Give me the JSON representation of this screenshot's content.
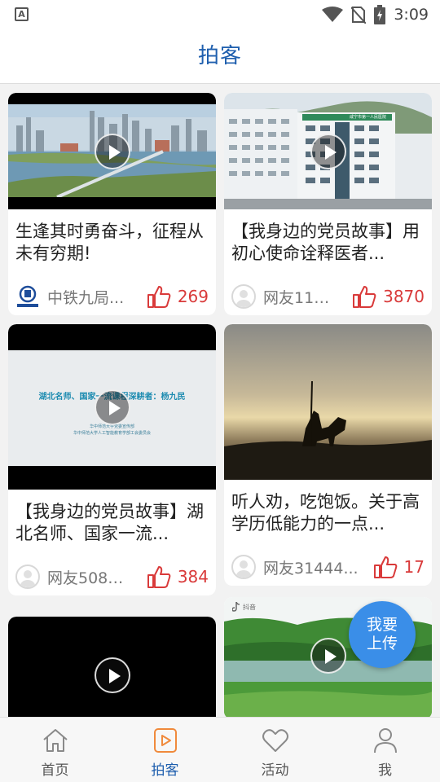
{
  "status_bar": {
    "time": "3:09",
    "app_badge": "A",
    "icons": [
      "wifi-icon",
      "no-sim-icon",
      "battery-charging-icon"
    ]
  },
  "header": {
    "title": "拍客"
  },
  "feed": {
    "left": [
      {
        "title": "生逢其时勇奋斗，征程从未有穷期!",
        "author": "中铁九局...",
        "likes": "269",
        "avatar": "logo",
        "logo_text": "中国中铁"
      },
      {
        "title": "【我身边的党员故事】湖北名师、国家一流...",
        "author": "网友5085...",
        "likes": "384",
        "avatar": "default",
        "thumb_text": {
          "headline": "湖北名师、国家一流课程深耕者：杨九民",
          "line1": "华中师范大学党委宣传部",
          "line2": "华中师范大学人工智能教育学部工会委员会"
        }
      },
      {
        "title": "",
        "author": "",
        "likes": "",
        "avatar": "none"
      }
    ],
    "right": [
      {
        "title": "【我身边的党员故事】用初心使命诠释医者...",
        "author": "网友118...",
        "likes": "3870",
        "avatar": "default",
        "thumb_text": {
          "sign": "咸宁市第一人民医院"
        }
      },
      {
        "title": "听人劝，吃饱饭。关于高学历低能力的一点...",
        "author": "网友31444...",
        "likes": "17",
        "avatar": "default"
      },
      {
        "title": "",
        "author": "",
        "likes": "",
        "avatar": "none",
        "thumb_text": {
          "watermark": "抖音"
        }
      }
    ]
  },
  "upload_fab": {
    "line1": "我要",
    "line2": "上传"
  },
  "bottom_nav": [
    {
      "label": "首页",
      "icon": "home-icon",
      "active": false
    },
    {
      "label": "拍客",
      "icon": "video-play-icon",
      "active": true
    },
    {
      "label": "活动",
      "icon": "heart-icon",
      "active": false
    },
    {
      "label": "我",
      "icon": "person-icon",
      "active": false
    }
  ],
  "colors": {
    "accent": "#1f5fae",
    "like": "#d93a3a",
    "fab": "#3a8ee8"
  }
}
